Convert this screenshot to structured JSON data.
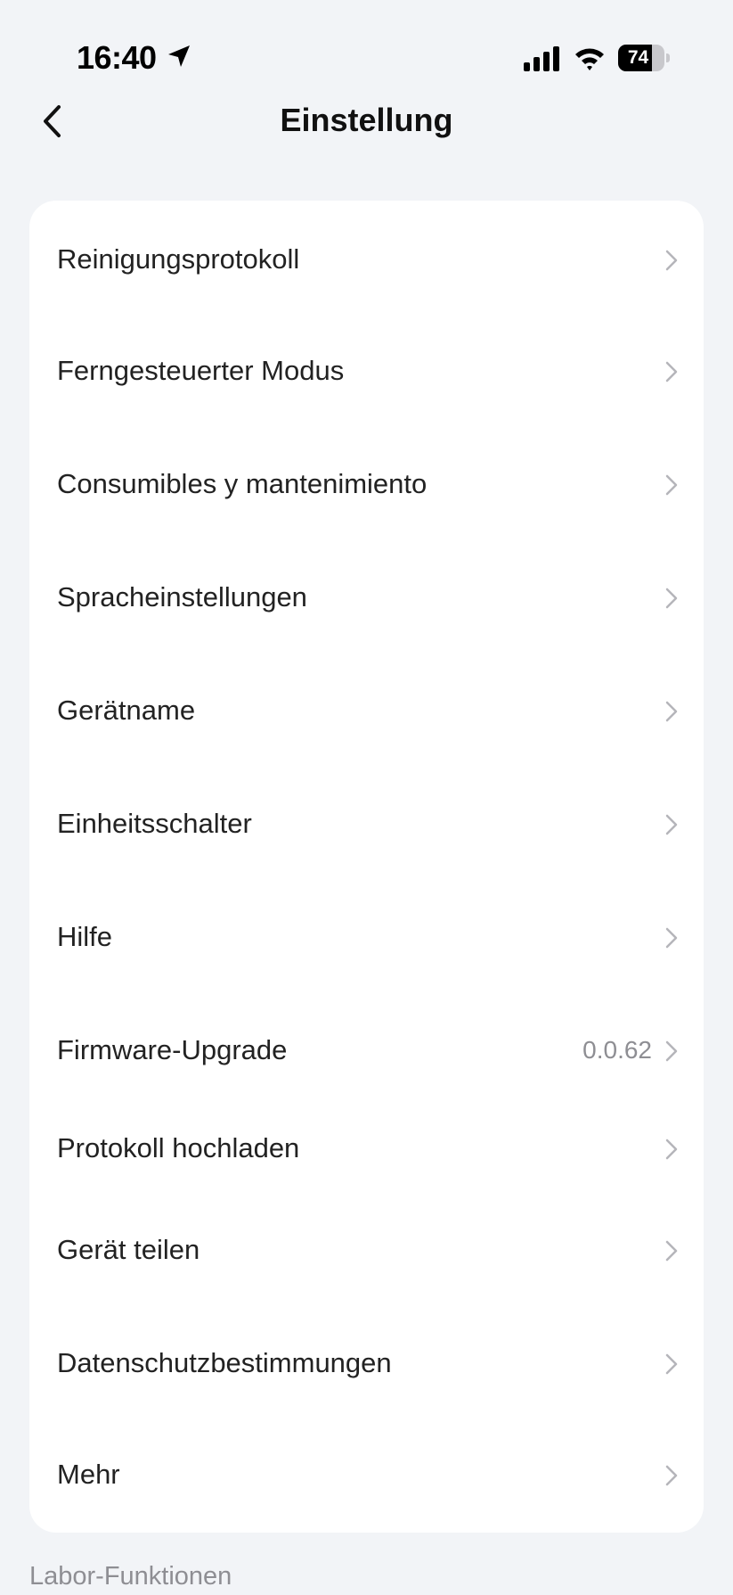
{
  "status_bar": {
    "time": "16:40",
    "battery_level": "74",
    "battery_fraction": 0.74
  },
  "header": {
    "title": "Einstellung",
    "back_icon": "chevron-left-icon"
  },
  "settings_items": [
    {
      "label": "Reinigungsprotokoll",
      "value": ""
    },
    {
      "label": "Ferngesteuerter Modus",
      "value": ""
    },
    {
      "label": "Consumibles y mantenimiento",
      "value": ""
    },
    {
      "label": "Spracheinstellungen",
      "value": ""
    },
    {
      "label": "Gerätname",
      "value": ""
    },
    {
      "label": "Einheitsschalter",
      "value": ""
    },
    {
      "label": "Hilfe",
      "value": ""
    },
    {
      "label": "Firmware-Upgrade",
      "value": "0.0.62"
    },
    {
      "label": "Protokoll hochladen",
      "value": ""
    },
    {
      "label": "Gerät teilen",
      "value": ""
    },
    {
      "label": "Datenschutzbestimmungen",
      "value": ""
    },
    {
      "label": "Mehr",
      "value": ""
    }
  ],
  "lab_section": {
    "label": "Labor-Funktionen"
  },
  "colors": {
    "background": "#f2f4f7",
    "card": "#ffffff",
    "text": "#222222",
    "secondary_text": "#8e8e93",
    "chevron": "#b5b5ba"
  }
}
